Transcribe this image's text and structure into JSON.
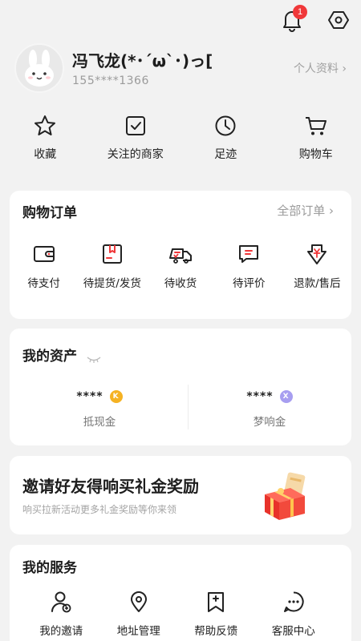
{
  "header": {
    "notification_count": "1",
    "icons": {
      "notification": "bell-icon",
      "settings": "hexagon-settings-icon"
    }
  },
  "profile": {
    "name": "冯飞龙(*･´ω`･)っ[",
    "phone": "155****1366",
    "profile_link": "个人资料 ›",
    "avatar_icon": "bunny-avatar-icon"
  },
  "quick_links": [
    {
      "label": "收藏",
      "icon": "star-icon"
    },
    {
      "label": "关注的商家",
      "icon": "checkbox-icon"
    },
    {
      "label": "足迹",
      "icon": "clock-icon"
    },
    {
      "label": "购物车",
      "icon": "cart-icon"
    }
  ],
  "orders": {
    "title": "购物订单",
    "all_link": "全部订单 ›",
    "items": [
      {
        "label": "待支付",
        "icon": "wallet-icon"
      },
      {
        "label": "待提货/发货",
        "icon": "package-icon"
      },
      {
        "label": "待收货",
        "icon": "truck-icon"
      },
      {
        "label": "待评价",
        "icon": "comment-icon"
      },
      {
        "label": "退款/售后",
        "icon": "refund-icon"
      }
    ]
  },
  "assets": {
    "title": "我的资产",
    "items": [
      {
        "value": "****",
        "name": "抵现金",
        "coin_letter": "K",
        "coin_color": "#f5b223"
      },
      {
        "value": "****",
        "name": "梦响金",
        "coin_letter": "X",
        "coin_color": "#a79ef0"
      }
    ]
  },
  "invite": {
    "title": "邀请好友得响买礼金奖励",
    "subtitle": "响买拉新活动更多礼金奖励等你来领"
  },
  "services": {
    "title": "我的服务",
    "items": [
      {
        "label": "我的邀请",
        "icon": "add-user-icon"
      },
      {
        "label": "地址管理",
        "icon": "location-icon"
      },
      {
        "label": "帮助反馈",
        "icon": "help-bookmark-icon"
      },
      {
        "label": "客服中心",
        "icon": "chat-icon"
      }
    ]
  },
  "colors": {
    "accent_red": "#f0383a",
    "background": "#f2f2f2",
    "card": "#ffffff"
  }
}
